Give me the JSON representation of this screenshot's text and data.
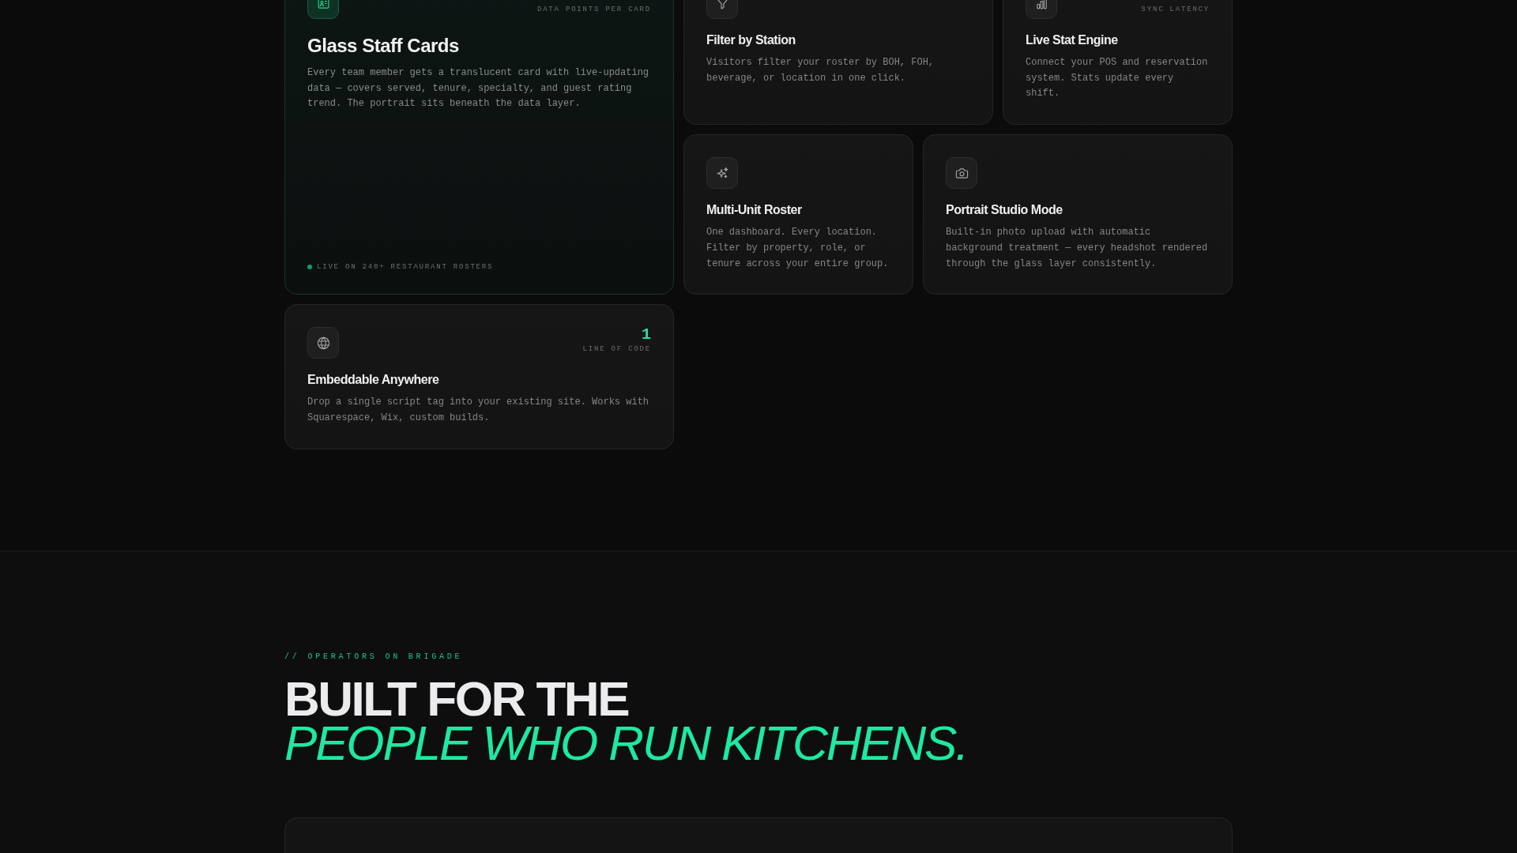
{
  "features": {
    "cards": [
      {
        "kind": "featured",
        "stat_label": "DATA POINTS PER CARD",
        "title": "Glass Staff Cards",
        "description": "Every team member gets a translucent card with live-updating data — covers served, tenure, specialty, and guest rating trend. The portrait sits beneath the data layer.",
        "footnote": "LIVE ON 240+ RESTAURANT ROSTERS"
      },
      {
        "kind": "standard",
        "title": "Filter by Station",
        "description": "Visitors filter your roster by BOH, FOH, beverage, or location in one click."
      },
      {
        "kind": "standard",
        "stat_label": "SYNC LATENCY",
        "title": "Live Stat Engine",
        "description": "Connect your POS and reservation system. Stats update every shift."
      },
      {
        "kind": "standard",
        "title": "Multi-Unit Roster",
        "description": "One dashboard. Every location. Filter by property, role, or tenure across your entire group."
      },
      {
        "kind": "standard",
        "title": "Portrait Studio Mode",
        "description": "Built-in photo upload with automatic background treatment — every headshot rendered through the glass layer consistently."
      },
      {
        "kind": "standard",
        "stat_value": "1",
        "stat_label": "LINE OF CODE",
        "title": "Embeddable Anywhere",
        "description": "Drop a single script tag into your existing site. Works with Squarespace, Wix, custom builds."
      }
    ]
  },
  "operators": {
    "eyebrow": "// OPERATORS ON BRIGADE",
    "headline": "BUILT FOR THE",
    "headline_accent": "PEOPLE WHO RUN KITCHENS."
  }
}
